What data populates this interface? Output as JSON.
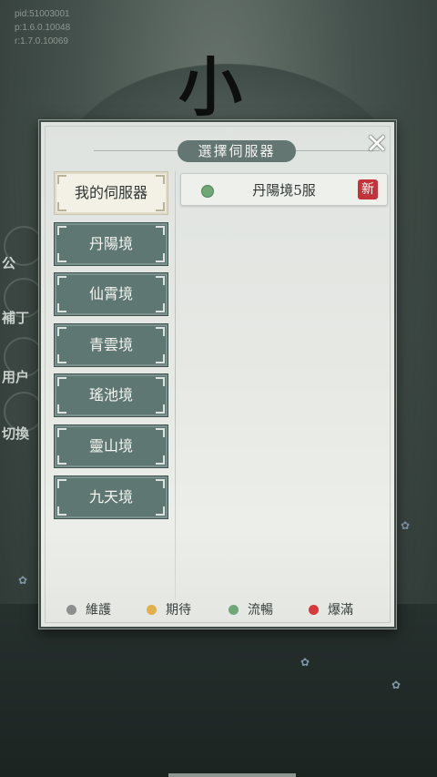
{
  "debug": {
    "lines": [
      "pid:51003001",
      "p:1.6.0.10048",
      "r:1.7.0.10069"
    ]
  },
  "background": {
    "side_labels": [
      "公",
      "補丁",
      "用户",
      "切換"
    ]
  },
  "dialog": {
    "title": "選擇伺服器",
    "close_icon": "close-x-icon",
    "my_servers_label": "我的伺服器",
    "regions": [
      {
        "label": "丹陽境"
      },
      {
        "label": "仙霄境"
      },
      {
        "label": "青雲境"
      },
      {
        "label": "瑤池境"
      },
      {
        "label": "靈山境"
      },
      {
        "label": "九天境"
      }
    ],
    "servers": [
      {
        "name": "丹陽境5服",
        "status": "流暢",
        "status_color": "#6fa777",
        "badge": "新"
      }
    ],
    "legend": [
      {
        "label": "維護",
        "color": "#8c8f8d"
      },
      {
        "label": "期待",
        "color": "#e0b04a"
      },
      {
        "label": "流暢",
        "color": "#6fa777"
      },
      {
        "label": "爆滿",
        "color": "#d8383a"
      }
    ]
  },
  "colors": {
    "accent": "#5e7773",
    "badge_new": "#c4333a"
  }
}
